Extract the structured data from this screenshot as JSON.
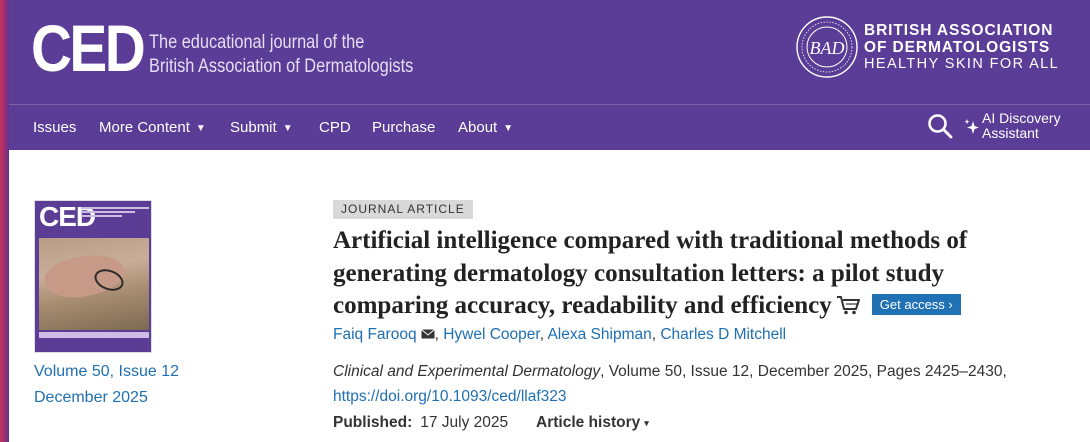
{
  "header": {
    "logo_text": "CED",
    "tagline_line1": "The educational journal of the",
    "tagline_line2": "British Association of Dermatologists",
    "society_logo_text": "BAD",
    "society_line1": "BRITISH ASSOCIATION",
    "society_line2": "OF DERMATOLOGISTS",
    "society_line3": "HEALTHY SKIN FOR ALL"
  },
  "nav": {
    "items": [
      {
        "label": "Issues",
        "dropdown": false
      },
      {
        "label": "More Content",
        "dropdown": true
      },
      {
        "label": "Submit",
        "dropdown": true
      },
      {
        "label": "CPD",
        "dropdown": false
      },
      {
        "label": "Purchase",
        "dropdown": false
      },
      {
        "label": "About",
        "dropdown": true
      }
    ],
    "caret": "▼",
    "search_icon": "search-icon",
    "ai_line1": "AI Discovery",
    "ai_line2": "Assistant"
  },
  "sidebar": {
    "cover_title": "CED",
    "volume_issue": "Volume 50, Issue 12",
    "issue_date": "December 2025"
  },
  "article": {
    "type": "JOURNAL ARTICLE",
    "title": "Artificial intelligence compared with traditional methods of generating dermatology consultation letters: a pilot study comparing accuracy, readability and efficiency",
    "access_button": "Get access ›",
    "authors": [
      "Faiq Farooq",
      "Hywel Cooper",
      "Alexa Shipman",
      "Charles D Mitchell"
    ],
    "journal": "Clinical and Experimental Dermatology",
    "citation_rest": ", Volume 50, Issue 12, December 2025, Pages 2425–2430,",
    "doi": "https://doi.org/10.1093/ced/llaf323",
    "published_label": "Published:",
    "published_date": "17 July 2025",
    "history_label": "Article history",
    "history_caret": "▾"
  },
  "colors": {
    "brand_purple": "#5b3c96",
    "link_blue": "#1f6fb2",
    "button_blue": "#2171b5"
  }
}
